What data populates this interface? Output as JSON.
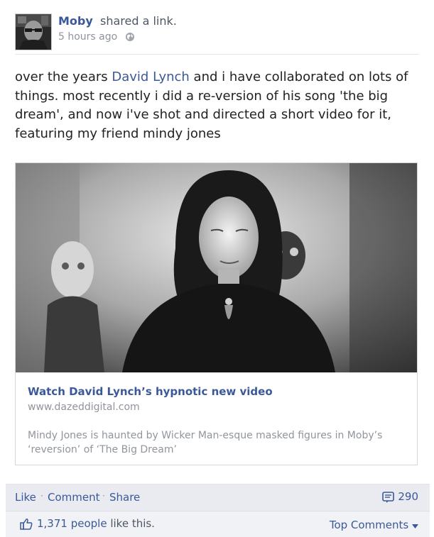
{
  "post": {
    "author": "Moby",
    "action": "shared a link.",
    "timestamp": "5 hours ago",
    "privacy_icon": "globe-icon",
    "message_part1": "over the years ",
    "message_mention": "David Lynch",
    "message_part2": " and i have collaborated on lots of things. most recently i did a re-version of his song 'the big dream', and now i've shot and directed a short video for it, featuring my friend mindy jones"
  },
  "link": {
    "title": "Watch David Lynch’s hypnotic new video",
    "domain": "www.dazeddigital.com",
    "description": "Mindy Jones is haunted by Wicker Man-esque masked figures in Moby’s ‘reversion’ of ‘The Big Dream’"
  },
  "actions": {
    "like": "Like",
    "comment": "Comment",
    "share": "Share",
    "separator": "·",
    "share_count": "290"
  },
  "likes": {
    "count": "1,371 people",
    "suffix": " like this.",
    "top_comments": "Top Comments"
  },
  "colors": {
    "link_blue": "#3b5998",
    "meta_gray": "#90949c",
    "action_bar_bg": "#e9ebf0"
  }
}
